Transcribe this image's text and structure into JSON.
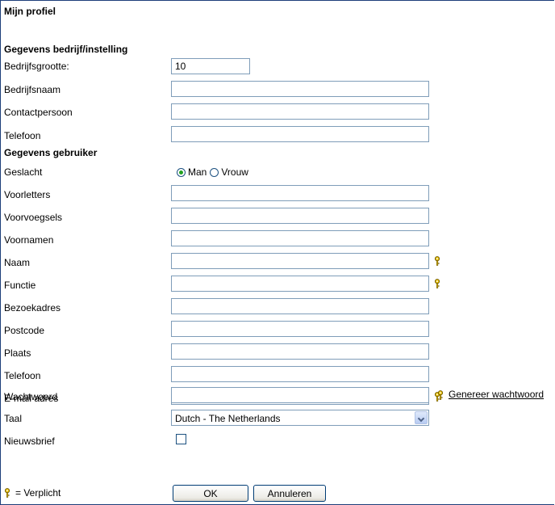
{
  "page_title": "Mijn profiel",
  "sections": {
    "company": "Gegevens bedrijf/instelling",
    "user": "Gegevens gebruiker"
  },
  "labels": {
    "company_size": "Bedrijfsgrootte:",
    "company_name": "Bedrijfsnaam",
    "contact": "Contactpersoon",
    "company_phone": "Telefoon",
    "gender": "Geslacht",
    "initials": "Voorletters",
    "prefixes": "Voorvoegsels",
    "first_names": "Voornamen",
    "last_name": "Naam",
    "function": "Functie",
    "visit_address": "Bezoekadres",
    "postcode": "Postcode",
    "city": "Plaats",
    "user_phone": "Telefoon",
    "email": "E-mail adres",
    "password": "Wachtwoord",
    "language": "Taal",
    "newsletter": "Nieuwsbrief"
  },
  "values": {
    "company_size": "10",
    "company_name": "",
    "contact": "",
    "company_phone": "",
    "initials": "",
    "prefixes": "",
    "first_names": "",
    "last_name": "",
    "function": "",
    "visit_address": "",
    "postcode": "",
    "city": "",
    "user_phone": "",
    "email": "",
    "password": "",
    "newsletter_checked": false
  },
  "gender_options": {
    "male": "Man",
    "female": "Vrouw",
    "selected": "Man"
  },
  "language": {
    "selected": "Dutch - The Netherlands"
  },
  "generate_password_link": "Genereer wachtwoord",
  "legend_text": "= Verplicht",
  "buttons": {
    "ok": "OK",
    "cancel": "Annuleren"
  },
  "icons": {
    "required": "key-icon"
  },
  "colors": {
    "frame_border": "#1d3f7a",
    "input_border": "#7f9db9",
    "key_icon": "#e8c000",
    "radio_dot": "#21a121"
  }
}
